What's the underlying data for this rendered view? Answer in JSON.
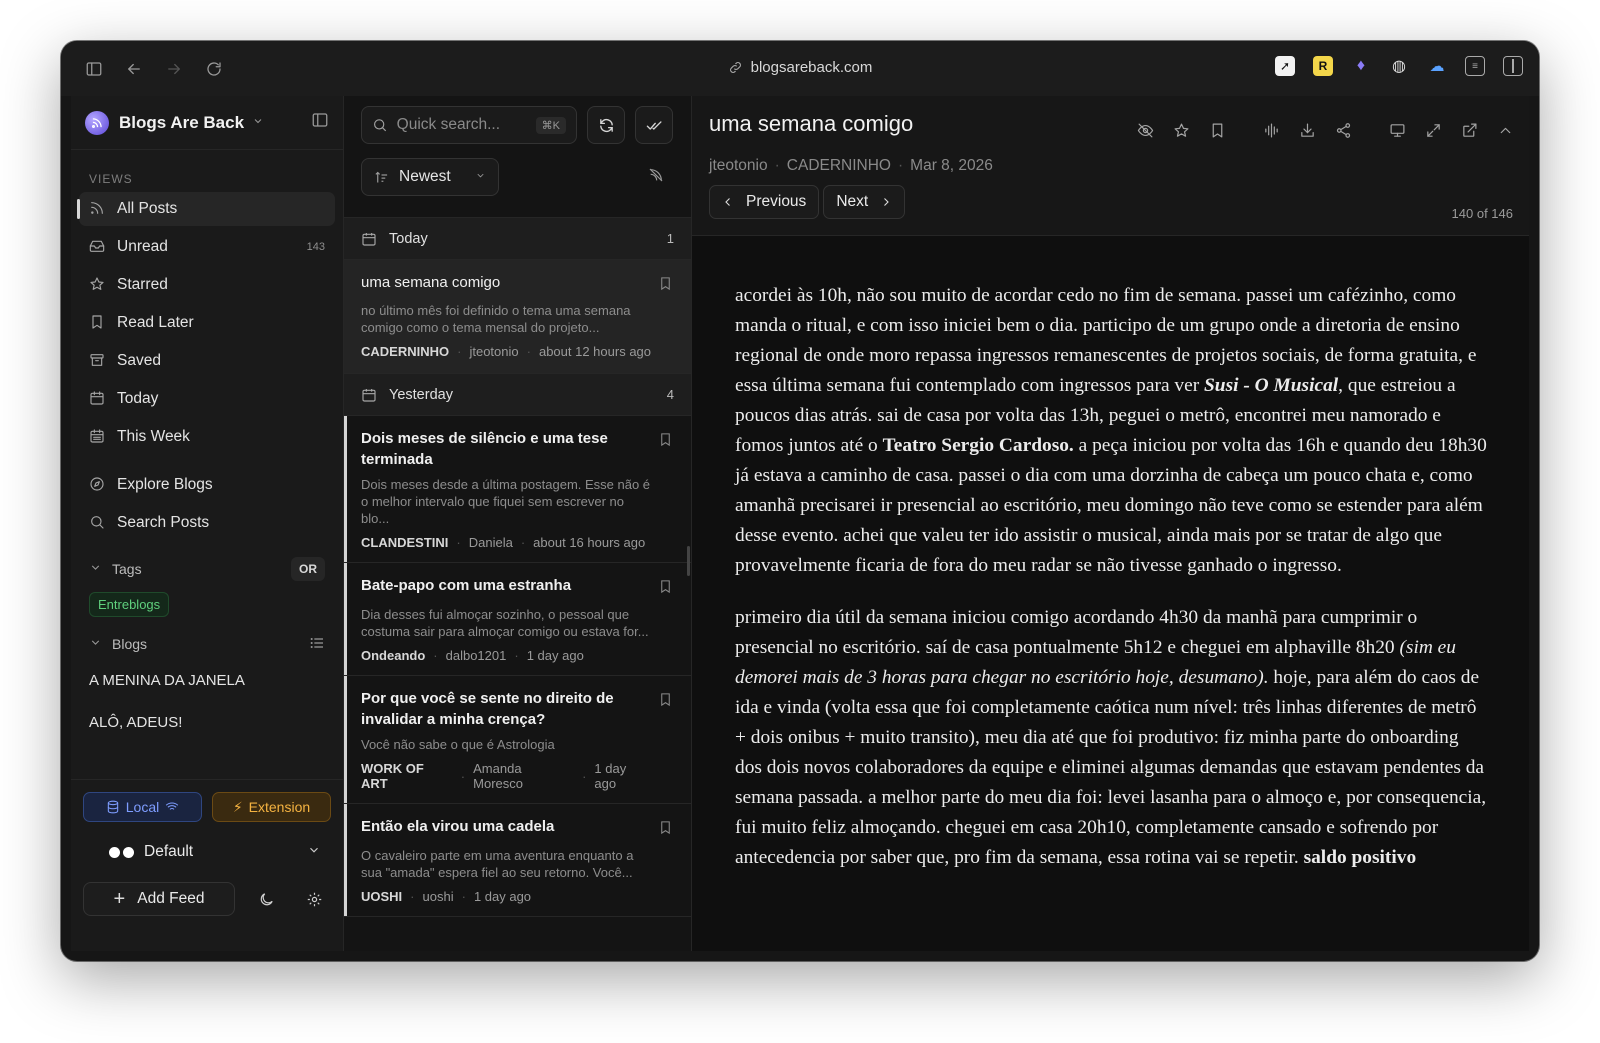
{
  "browser": {
    "url": "blogsareback.com"
  },
  "sidebar": {
    "app_name": "Blogs Are Back",
    "views_label": "VIEWS",
    "views": [
      {
        "label": "All Posts",
        "icon": "rss-icon",
        "count": ""
      },
      {
        "label": "Unread",
        "icon": "inbox-icon",
        "count": "143"
      },
      {
        "label": "Starred",
        "icon": "star-icon",
        "count": ""
      },
      {
        "label": "Read Later",
        "icon": "bookmark-icon",
        "count": ""
      },
      {
        "label": "Saved",
        "icon": "archive-icon",
        "count": ""
      },
      {
        "label": "Today",
        "icon": "calendar-icon",
        "count": ""
      },
      {
        "label": "This Week",
        "icon": "calendar-week-icon",
        "count": ""
      }
    ],
    "explore": [
      {
        "label": "Explore Blogs",
        "icon": "compass-icon"
      },
      {
        "label": "Search Posts",
        "icon": "search-icon"
      }
    ],
    "tags_label": "Tags",
    "tags_mode": "OR",
    "tags": [
      "Entreblogs"
    ],
    "blogs_label": "Blogs",
    "blogs": [
      "A MENINA DA JANELA",
      "ALÔ, ADEUS!"
    ],
    "mode_local": "Local",
    "mode_extension": "Extension",
    "theme": "Default",
    "add_feed": "Add Feed"
  },
  "postlist": {
    "search_placeholder": "Quick search...",
    "search_shortcut": "⌘K",
    "sort": "Newest",
    "groups": [
      {
        "label": "Today",
        "count": "1",
        "posts": [
          {
            "title": "uma semana comigo",
            "excerpt": "no último mês foi definido o tema uma semana comigo como o tema mensal do projeto...",
            "source": "CADERNINHO",
            "author": "jteotonio",
            "time": "about 12 hours ago"
          }
        ]
      },
      {
        "label": "Yesterday",
        "count": "4",
        "posts": [
          {
            "title": "Dois meses de silêncio e uma tese terminada",
            "excerpt": "Dois meses desde a última postagem. Esse não é o melhor intervalo que fiquei sem escrever no blo...",
            "source": "CLANDESTINI",
            "author": "Daniela",
            "time": "about 16 hours ago"
          },
          {
            "title": "Bate-papo com uma estranha",
            "excerpt": "Dia desses fui almoçar sozinho, o pessoal que costuma sair para almoçar comigo ou estava for...",
            "source": "Ondeando",
            "author": "dalbo1201",
            "time": "1 day ago"
          },
          {
            "title": "Por que você se sente no direito de invalidar a minha crença?",
            "excerpt": "Você não sabe o que é Astrologia",
            "source": "WORK OF ART",
            "author": "Amanda Moresco",
            "time": "1 day ago"
          },
          {
            "title": "Então ela virou uma cadela",
            "excerpt": "O cavaleiro parte em uma aventura enquanto a sua \"amada\" espera fiel ao seu retorno. Você...",
            "source": "UOSHI",
            "author": "uoshi",
            "time": "1 day ago"
          }
        ]
      }
    ]
  },
  "reader": {
    "title": "uma semana comigo",
    "author": "jteotonio",
    "source": "CADERNINHO",
    "date": "Mar 8, 2026",
    "previous": "Previous",
    "next": "Next",
    "position": "140 of 146",
    "p1_a": "acordei às 10h, não sou muito de acordar cedo no fim de semana. passei um cafézinho, como manda o ritual, e com isso iniciei bem o dia. participo de um grupo onde a diretoria de ensino regional de onde moro repassa ingressos remanescentes de projetos sociais, de forma gratuita, e essa última semana fui contemplado com ingressos para ver ",
    "p1_b": "Susi - O Musical",
    "p1_c": ", que estreiou a poucos dias atrás. sai de casa por volta das 13h, peguei o metrô, encontrei meu namorado e fomos juntos até o ",
    "p1_d": "Teatro Sergio Cardoso.",
    "p1_e": " a peça iniciou por volta das 16h e quando deu 18h30 já estava a caminho de casa. passei o dia com uma dorzinha de cabeça um pouco chata e, como amanhã precisarei ir presencial ao escritório, meu domingo não teve como se estender para além desse evento. achei que valeu ter ido assistir o musical, ainda mais por se tratar de algo que provavelmente ficaria de fora do meu radar se não tivesse ganhado o ingresso.",
    "p2_a": "primeiro dia útil da semana iniciou comigo acordando 4h30 da manhã para cumprimir o presencial no escritório. saí de casa pontualmente 5h12 e cheguei em alphaville 8h20 ",
    "p2_b": "(sim eu demorei mais de 3 horas para chegar no escritório hoje, desumano).",
    "p2_c": " hoje, para além do caos de ida e vinda (volta essa que foi completamente caótica num nível: três linhas diferentes de metrô + dois onibus + muito transito), meu dia até que foi produtivo: fiz minha parte do onboarding dos dois novos colaboradores da equipe e eliminei algumas demandas que estavam pendentes da semana passada. a melhor parte do meu dia foi: levei lasanha para o almoço e, por consequencia, fui muito feliz almoçando. cheguei em casa 20h10, completamente cansado e sofrendo por antecedencia por saber que, pro fim da semana, essa rotina vai se repetir. ",
    "p2_d": "saldo positivo"
  }
}
